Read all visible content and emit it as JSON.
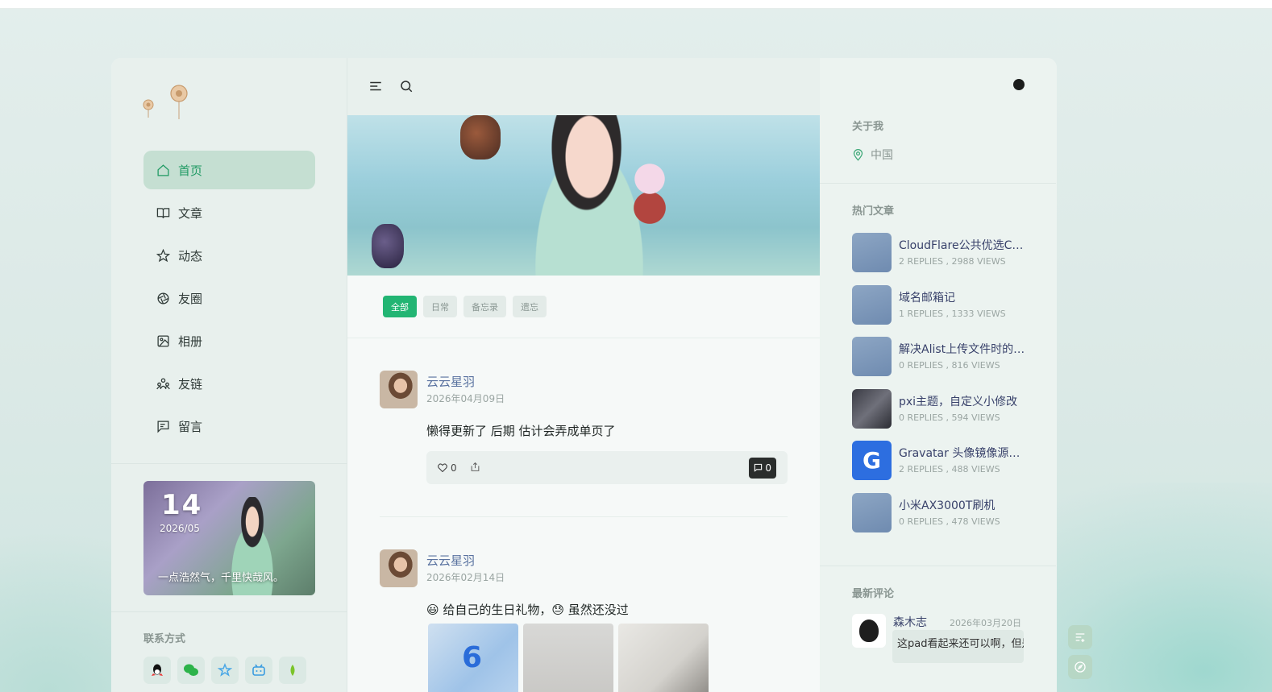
{
  "nav": {
    "items": [
      {
        "label": "首页",
        "icon": "home-icon"
      },
      {
        "label": "文章",
        "icon": "book-icon"
      },
      {
        "label": "动态",
        "icon": "star-icon"
      },
      {
        "label": "友圈",
        "icon": "aperture-icon"
      },
      {
        "label": "相册",
        "icon": "image-icon"
      },
      {
        "label": "友链",
        "icon": "users-icon"
      },
      {
        "label": "留言",
        "icon": "message-icon"
      }
    ]
  },
  "calendar": {
    "day": "14",
    "month": "2026/05",
    "quote": "一点浩然气，千里快哉风。"
  },
  "contact": {
    "title": "联系方式",
    "icons": [
      "qq-icon",
      "wechat-icon",
      "qzone-icon",
      "bilibili-icon",
      "weather-icon"
    ]
  },
  "tags": [
    "全部",
    "日常",
    "备忘录",
    "遗忘"
  ],
  "posts": [
    {
      "author": "云云星羽",
      "date": "2026年04月09日",
      "text": "懒得更新了  后期 估计会弄成单页了",
      "likes": "0",
      "comments": "0"
    },
    {
      "author": "云云星羽",
      "date": "2026年02月14日",
      "text": "😃 给自己的生日礼物，😓 虽然还没过"
    }
  ],
  "sidebar": {
    "about_title": "关于我",
    "location": "中国",
    "hot_title": "热门文章",
    "hot": [
      {
        "title": "CloudFlare公共优选CnameCDN",
        "meta": "2 REPLIES ,   2988 VIEWS",
        "thumb": "plain"
      },
      {
        "title": "域名邮箱记",
        "meta": "1 REPLIES ,   1333 VIEWS",
        "thumb": "plain"
      },
      {
        "title": "解决Alist上传文件时的问题",
        "meta": "0 REPLIES ,   816 VIEWS",
        "thumb": "plain"
      },
      {
        "title": "pxi主题，自定义小修改",
        "meta": "0 REPLIES ,   594 VIEWS",
        "thumb": "dark"
      },
      {
        "title": "Gravatar 头像镜像源收集",
        "meta": "2 REPLIES ,   488 VIEWS",
        "thumb": "blue"
      },
      {
        "title": "小米AX3000T刷机",
        "meta": "0 REPLIES ,   478 VIEWS",
        "thumb": "plain"
      }
    ],
    "comments_title": "最新评论",
    "comment": {
      "name": "森木志",
      "date": "2026年03月20日",
      "text": "这pad看起来还可以啊，但是"
    }
  },
  "colors": {
    "accent": "#22b573",
    "nav_active_bg": "#c5dfd2",
    "link": "#5a73a0"
  }
}
